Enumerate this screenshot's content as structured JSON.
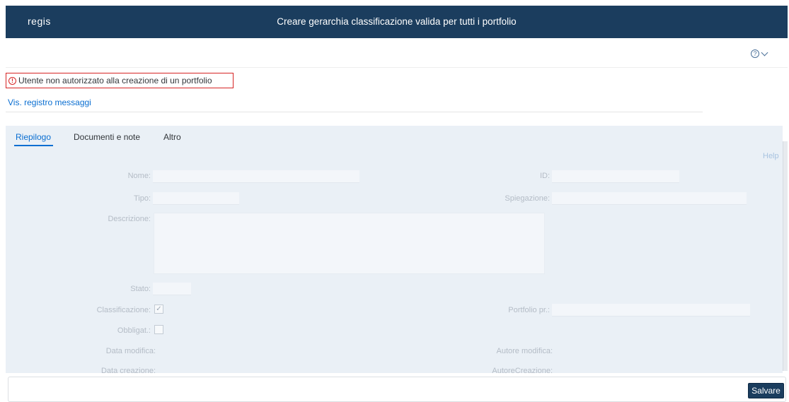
{
  "header": {
    "logo": "regis",
    "title": "Creare gerarchia classificazione valida per tutti i portfolio"
  },
  "help_icon": "question-circle-icon",
  "message": {
    "icon": "!",
    "text": "Utente non autorizzato alla creazione di un portfolio"
  },
  "log_link": "Vis. registro messaggi",
  "tabs": [
    {
      "label": "Riepilogo",
      "active": true
    },
    {
      "label": "Documenti e note",
      "active": false
    },
    {
      "label": "Altro",
      "active": false
    }
  ],
  "help_link": "Help",
  "form": {
    "nome": "Nome:",
    "id": "ID:",
    "tipo": "Tipo:",
    "spiegazione": "Spiegazione:",
    "descrizione": "Descrizione:",
    "stato": "Stato:",
    "classificazione": "Classificazione:",
    "classificazione_checked": true,
    "portfolio_pr": "Portfolio pr.:",
    "obbligat": "Obbligat.:",
    "obbligat_checked": false,
    "data_modifica": "Data modifica:",
    "autore_modifica": "Autore modifica:",
    "data_creazione": "Data creazione:",
    "autore_creazione": "AutoreCreazione:"
  },
  "footer": {
    "save_label": "Salvare"
  },
  "colors": {
    "header_bg": "#1b3d5e",
    "link": "#0a6ed1",
    "error": "#d62424",
    "panel_bg": "#eaf0f6"
  }
}
